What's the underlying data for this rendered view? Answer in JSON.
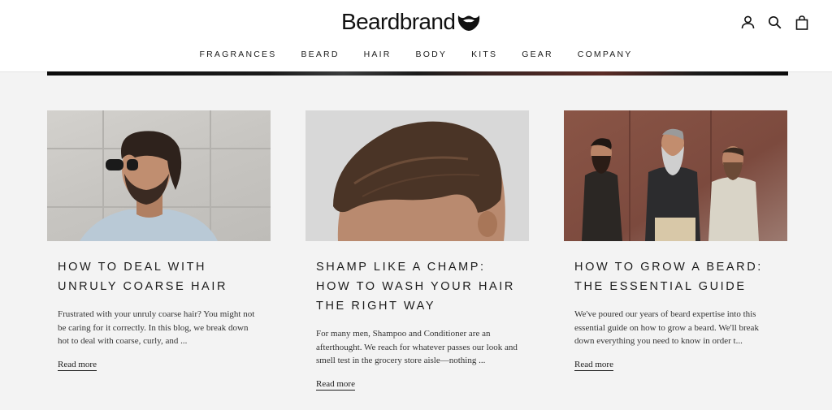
{
  "brand": {
    "name": "Beardbrand",
    "logo_icon": "beard-icon"
  },
  "header_icons": [
    "account-icon",
    "search-icon",
    "cart-icon"
  ],
  "nav": [
    {
      "label": "FRAGRANCES"
    },
    {
      "label": "BEARD"
    },
    {
      "label": "HAIR"
    },
    {
      "label": "BODY"
    },
    {
      "label": "KITS"
    },
    {
      "label": "GEAR"
    },
    {
      "label": "COMPANY"
    }
  ],
  "articles": [
    {
      "title_line1": "HOW TO DEAL WITH",
      "title_line2": "UNRULY COARSE HAIR",
      "title_line3": "",
      "excerpt": "Frustrated with your unruly coarse hair? You might not be caring for it correctly. In this blog, we break down hot to deal with coarse, curly, and ...",
      "link": "Read more"
    },
    {
      "title_line1": "SHAMP LIKE A CHAMP:",
      "title_line2": "HOW TO WASH YOUR HAIR",
      "title_line3": "THE RIGHT WAY",
      "excerpt": "For many men, Shampoo and Conditioner are an afterthought. We reach for whatever passes our look and smell test in the grocery store aisle—nothing ...",
      "link": "Read more"
    },
    {
      "title_line1": "HOW TO GROW A BEARD:",
      "title_line2": "THE ESSENTIAL GUIDE",
      "title_line3": "",
      "excerpt": "We've poured our years of beard expertise into this essential guide on how to grow a beard. We'll break down everything you need to know in order t...",
      "link": "Read more"
    }
  ],
  "colors": {
    "header_bg": "#ffffff",
    "page_bg": "#f3f3f3",
    "text": "#1c1c1c"
  }
}
